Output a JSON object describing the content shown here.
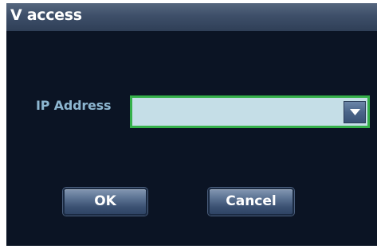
{
  "dialog": {
    "title": "V access",
    "ip_address": {
      "label": "IP Address",
      "value": "",
      "dropdown_icon": "chevron-down-icon"
    },
    "buttons": {
      "ok_label": "OK",
      "cancel_label": "Cancel"
    }
  },
  "colors": {
    "background": "#0b1424",
    "title_bar": "#3e4f69",
    "label_text": "#8db6d0",
    "input_fill": "#c5dee7",
    "input_focus_border": "#35b04a",
    "button_fill": "#4b6589"
  }
}
